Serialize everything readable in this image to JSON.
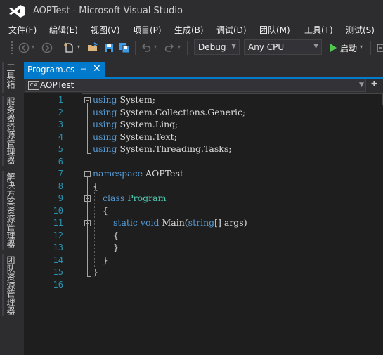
{
  "window": {
    "title": "AOPTest - Microsoft Visual Studio"
  },
  "menu": [
    {
      "label": "文件(F)"
    },
    {
      "label": "编辑(E)"
    },
    {
      "label": "视图(V)"
    },
    {
      "label": "项目(P)"
    },
    {
      "label": "生成(B)"
    },
    {
      "label": "调试(D)"
    },
    {
      "label": "团队(M)"
    },
    {
      "label": "工具(T)"
    },
    {
      "label": "测试(S)"
    }
  ],
  "toolbar": {
    "configuration": "Debug",
    "platform": "Any CPU",
    "start_label": "启动",
    "icons": [
      "back-icon",
      "forward-icon",
      "new-item-icon",
      "open-folder-icon",
      "save-icon",
      "save-all-icon",
      "undo-icon",
      "redo-icon",
      "start-icon"
    ]
  },
  "left_strip": {
    "tabs": [
      "工具箱",
      "服务器资源管理器",
      "解决方案资源管理器",
      "团队资源管理器"
    ]
  },
  "document_tab": {
    "title": "Program.cs",
    "pin_glyph": "⊣",
    "close_glyph": "✕"
  },
  "navbar": {
    "badge": "C#",
    "project": "AOPTest"
  },
  "editor": {
    "line_numbers": [
      "1",
      "2",
      "3",
      "4",
      "5",
      "6",
      "7",
      "8",
      "9",
      "10",
      "11",
      "12",
      "13",
      "14",
      "15",
      "16"
    ],
    "code": {
      "l1_kw": "using",
      "l1_rest": " System;",
      "l2_kw": "using",
      "l2_rest": " System.Collections.Generic;",
      "l3_kw": "using",
      "l3_rest": " System.Linq;",
      "l4_kw": "using",
      "l4_rest": " System.Text;",
      "l5_kw": "using",
      "l5_rest": " System.Threading.Tasks;",
      "l7_kw": "namespace",
      "l7_rest": " AOPTest",
      "l8": "{",
      "l9_kw": "class",
      "l9_type": "Program",
      "l10": "{",
      "l11_kw1": "static",
      "l11_kw2": "void",
      "l11_name": "Main(",
      "l11_kw3": "string",
      "l11_rest": "[] args)",
      "l12": "{",
      "l13": "}",
      "l14": "}",
      "l15": "}"
    }
  },
  "colors": {
    "keyword": "#569cd6",
    "type": "#4ec9b0",
    "line_number": "#2b91af",
    "accent": "#007acc",
    "editor_bg": "#1e1e1e"
  }
}
